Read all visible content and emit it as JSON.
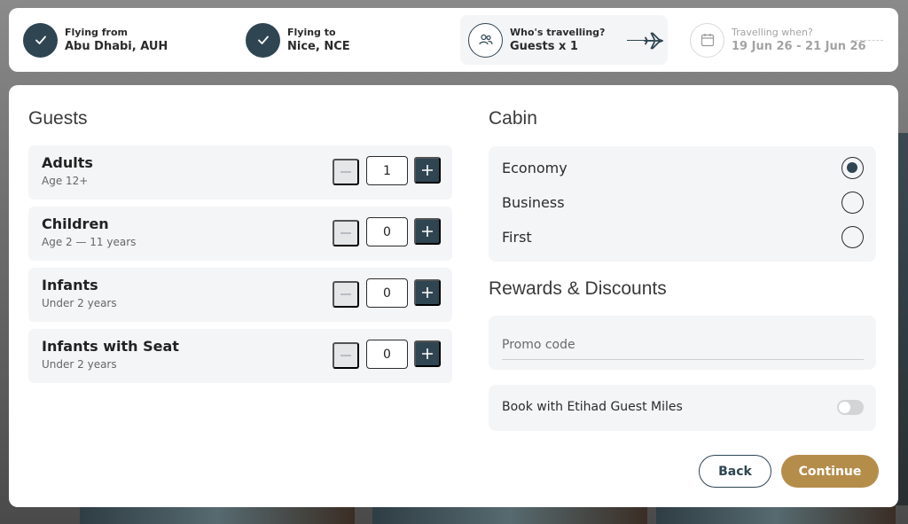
{
  "steps": {
    "from": {
      "label": "Flying from",
      "value": "Abu Dhabi, AUH",
      "icon": "check-icon"
    },
    "to": {
      "label": "Flying to",
      "value": "Nice, NCE",
      "icon": "check-icon"
    },
    "guests": {
      "label": "Who's travelling?",
      "value": "Guests x 1",
      "icon": "people-icon"
    },
    "dates": {
      "label": "Travelling when?",
      "value": "19 Jun 26 - 21 Jun 26",
      "icon": "calendar-icon"
    }
  },
  "guests": {
    "title": "Guests",
    "rows": [
      {
        "name": "Adults",
        "sub": "Age 12+",
        "count": "1"
      },
      {
        "name": "Children",
        "sub": "Age 2 — 11 years",
        "count": "0"
      },
      {
        "name": "Infants",
        "sub": "Under 2 years",
        "count": "0"
      },
      {
        "name": "Infants with Seat",
        "sub": "Under 2 years",
        "count": "0"
      }
    ]
  },
  "cabin": {
    "title": "Cabin",
    "options": [
      {
        "label": "Economy",
        "selected": true
      },
      {
        "label": "Business",
        "selected": false
      },
      {
        "label": "First",
        "selected": false
      }
    ]
  },
  "rewards": {
    "title": "Rewards & Discounts",
    "promo_placeholder": "Promo code",
    "promo_value": "",
    "miles_label": "Book with Etihad Guest Miles",
    "miles_enabled": false
  },
  "actions": {
    "back_label": "Back",
    "continue_label": "Continue"
  },
  "colors": {
    "primary": "#2f4552",
    "accent": "#b58d4b",
    "panel": "#f4f5f7"
  }
}
